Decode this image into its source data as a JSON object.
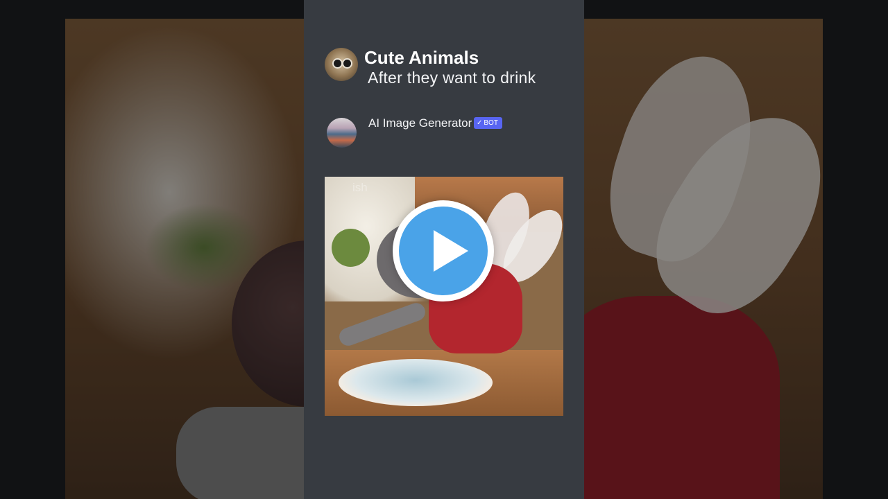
{
  "channel": {
    "name": "Cute Animals",
    "avatar_icon": "bug-face-avatar"
  },
  "post": {
    "subtitle": "After they want to drink"
  },
  "bot": {
    "name": "AI Image Generator",
    "badge_label": "BOT",
    "badge_icon": "check-icon",
    "badge_color": "#5865f2"
  },
  "media": {
    "watermark": "ish",
    "play_icon": "play-icon",
    "play_color": "#4aa3e8"
  },
  "colors": {
    "panel": "#373b41",
    "page_bg": "#111214"
  }
}
